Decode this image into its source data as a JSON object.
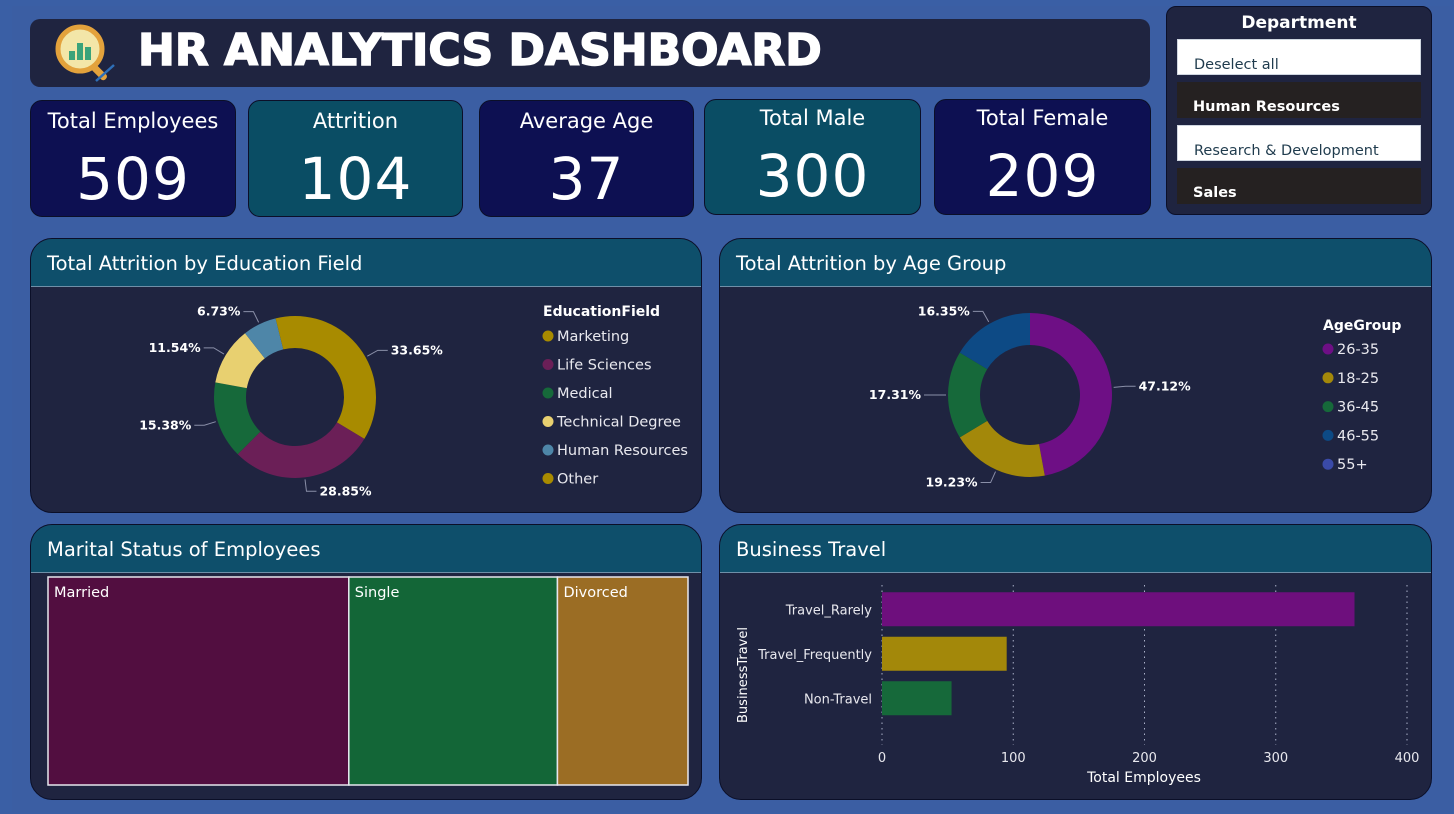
{
  "header": {
    "title": "HR ANALYTICS DASHBOARD",
    "logo_icon": "analytics-magnifier-icon"
  },
  "kpis": [
    {
      "label": "Total Employees",
      "value": "509",
      "color": "navy"
    },
    {
      "label": "Attrition",
      "value": "104",
      "color": "teal"
    },
    {
      "label": "Average Age",
      "value": "37",
      "color": "navy"
    },
    {
      "label": "Total Male",
      "value": "300",
      "color": "teal"
    },
    {
      "label": "Total Female",
      "value": "209",
      "color": "navy"
    }
  ],
  "department_slicer": {
    "title": "Department",
    "options": [
      {
        "label": "Deselect all",
        "selected": true
      },
      {
        "label": "Human Resources",
        "selected": false
      },
      {
        "label": "Research & Development",
        "selected": true
      },
      {
        "label": "Sales",
        "selected": false
      }
    ]
  },
  "panels": {
    "education": {
      "title": "Total Attrition by Education Field",
      "legend_title": "EducationField"
    },
    "age": {
      "title": "Total Attrition by Age Group",
      "legend_title": "AgeGroup"
    },
    "marital": {
      "title": "Marital Status of Employees"
    },
    "travel": {
      "title": "Business Travel"
    }
  },
  "colors": {
    "background": "#3b5ea3",
    "panel": "#1f2440",
    "panel_header": "#0e4f6b",
    "navy": "#0d1052",
    "teal": "#0a4d64"
  },
  "chart_data": [
    {
      "type": "pie",
      "subtype": "donut",
      "title": "Total Attrition by Education Field",
      "legend_title": "EducationField",
      "legend": [
        "Marketing",
        "Life Sciences",
        "Medical",
        "Technical Degree",
        "Human Resources",
        "Other"
      ],
      "slices": [
        {
          "name": "Marketing",
          "value": 33.65,
          "label": "33.65%",
          "color": "#a88b00"
        },
        {
          "name": "Life Sciences",
          "value": 28.85,
          "label": "28.85%",
          "color": "#6b1f57"
        },
        {
          "name": "Medical",
          "value": 15.38,
          "label": "15.38%",
          "color": "#16693a"
        },
        {
          "name": "Technical Degree",
          "value": 11.54,
          "label": "11.54%",
          "color": "#e8d070"
        },
        {
          "name": "Human Resources",
          "value": 6.73,
          "label": "6.73%",
          "color": "#4e86a8"
        },
        {
          "name": "Other",
          "value": 3.85,
          "label": "",
          "color": "#a88b00"
        }
      ]
    },
    {
      "type": "pie",
      "subtype": "donut",
      "title": "Total Attrition by Age Group",
      "legend_title": "AgeGroup",
      "legend": [
        "26-35",
        "18-25",
        "36-45",
        "46-55",
        "55+"
      ],
      "slices": [
        {
          "name": "26-35",
          "value": 47.12,
          "label": "47.12%",
          "color": "#6e0f85"
        },
        {
          "name": "18-25",
          "value": 19.23,
          "label": "19.23%",
          "color": "#a3880a"
        },
        {
          "name": "36-45",
          "value": 17.31,
          "label": "17.31%",
          "color": "#16693a"
        },
        {
          "name": "46-55",
          "value": 16.35,
          "label": "16.35%",
          "color": "#0d4a85"
        },
        {
          "name": "55+",
          "value": 0,
          "label": "",
          "color": "#3a4aa8"
        }
      ]
    },
    {
      "type": "treemap",
      "title": "Marital Status of Employees",
      "items": [
        {
          "name": "Married",
          "value": 47,
          "color": "#520e40"
        },
        {
          "name": "Single",
          "value": 32.6,
          "color": "#136637"
        },
        {
          "name": "Divorced",
          "value": 20.4,
          "color": "#9b6d24"
        }
      ]
    },
    {
      "type": "bar",
      "orientation": "horizontal",
      "title": "Business Travel",
      "categories": [
        "Travel_Rarely",
        "Travel_Frequently",
        "Non-Travel"
      ],
      "values": [
        360,
        95,
        53
      ],
      "colors": [
        "#6e0f7d",
        "#a3880a",
        "#16693a"
      ],
      "xlabel": "Total Employees",
      "ylabel": "BusinessTravel",
      "xlim": [
        0,
        400
      ],
      "xticks": [
        "0",
        "100",
        "200",
        "300",
        "400"
      ],
      "grid": true
    }
  ]
}
